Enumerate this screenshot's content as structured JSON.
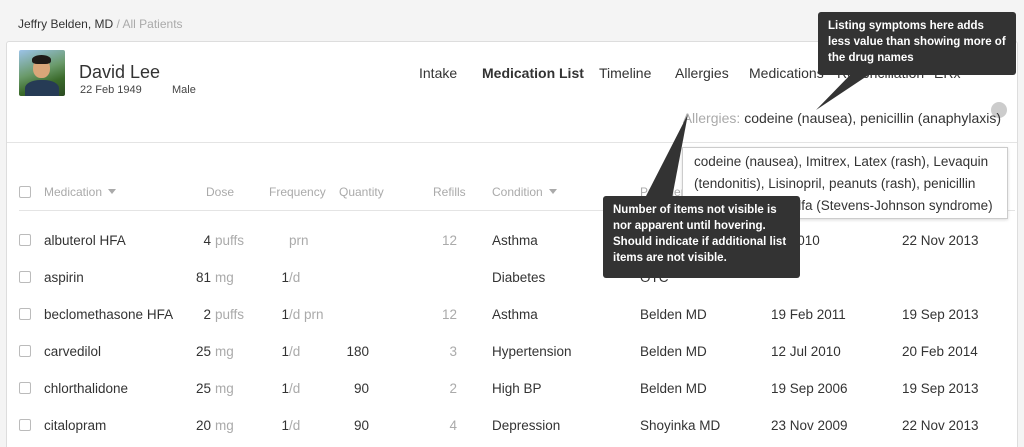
{
  "breadcrumb": {
    "doctor": "Jeffry Belden, MD",
    "separator": " / ",
    "current": "All Patients"
  },
  "patient": {
    "name": "David Lee",
    "dob": "22 Feb 1949",
    "sex": "Male"
  },
  "nav": [
    {
      "label": "Intake",
      "active": false
    },
    {
      "label": "Medication List",
      "active": true
    },
    {
      "label": "Timeline",
      "active": false
    },
    {
      "label": "Allergies",
      "active": false
    },
    {
      "label": "Medications",
      "active": false
    },
    {
      "label": "Reconciliation",
      "active": false
    },
    {
      "label": "ERx",
      "active": false
    }
  ],
  "allergies": {
    "label": "Allergies:",
    "summary": "codeine (nausea), penicillin (anaphylaxis)"
  },
  "allergy_popover": {
    "text": "codeine (nausea), Imitrex, Latex (rash), Levaquin (tendonitis), Lisinopril, peanuts (rash), penicillin (anaphylaxis), Sulfa (Stevens-Johnson syndrome)"
  },
  "columns": {
    "medication": "Medication",
    "dose": "Dose",
    "frequency": "Frequency",
    "quantity": "Quantity",
    "refills": "Refills",
    "condition": "Condition",
    "provider": "Provider"
  },
  "rows": [
    {
      "medication": "albuterol HFA",
      "dose_num": "4",
      "dose_unit": "puffs",
      "freq_num": "",
      "freq_unit": "prn",
      "quantity": "",
      "refills": "12",
      "condition": "Asthma",
      "provider": "",
      "start": "an 2010",
      "end": "22 Nov 2013"
    },
    {
      "medication": "aspirin",
      "dose_num": "81",
      "dose_unit": "mg",
      "freq_num": "1",
      "freq_unit": "/d",
      "quantity": "",
      "refills": "",
      "condition": "Diabetes",
      "provider": "OTC",
      "start": "",
      "end": ""
    },
    {
      "medication": "beclomethasone HFA",
      "dose_num": "2",
      "dose_unit": "puffs",
      "freq_num": "1",
      "freq_unit": "/d prn",
      "quantity": "",
      "refills": "12",
      "condition": "Asthma",
      "provider": "Belden MD",
      "start": "19 Feb 2011",
      "end": "19 Sep 2013"
    },
    {
      "medication": "carvedilol",
      "dose_num": "25",
      "dose_unit": "mg",
      "freq_num": "1",
      "freq_unit": "/d",
      "quantity": "180",
      "refills": "3",
      "condition": "Hypertension",
      "provider": "Belden MD",
      "start": "12  Jul  2010",
      "end": "20 Feb 2014"
    },
    {
      "medication": "chlorthalidone",
      "dose_num": "25",
      "dose_unit": "mg",
      "freq_num": "1",
      "freq_unit": "/d",
      "quantity": "90",
      "refills": "2",
      "condition": "High BP",
      "provider": "Belden MD",
      "start": "19 Sep 2006",
      "end": "19 Sep 2013"
    },
    {
      "medication": "citalopram",
      "dose_num": "20",
      "dose_unit": "mg",
      "freq_num": "1",
      "freq_unit": "/d",
      "quantity": "90",
      "refills": "4",
      "condition": "Depression",
      "provider": "Shoyinka MD",
      "start": "23 Nov 2009",
      "end": "22 Nov 2013"
    }
  ],
  "callouts": {
    "top": "Listing symptoms here adds less value than showing more of the drug names",
    "bottom": "Number of items not visible is nor apparent until hovering. Should indicate if additional list items are not visible."
  },
  "colors": {
    "callout_bg": "#333333",
    "muted": "#aaaaaa",
    "text": "#333333"
  }
}
